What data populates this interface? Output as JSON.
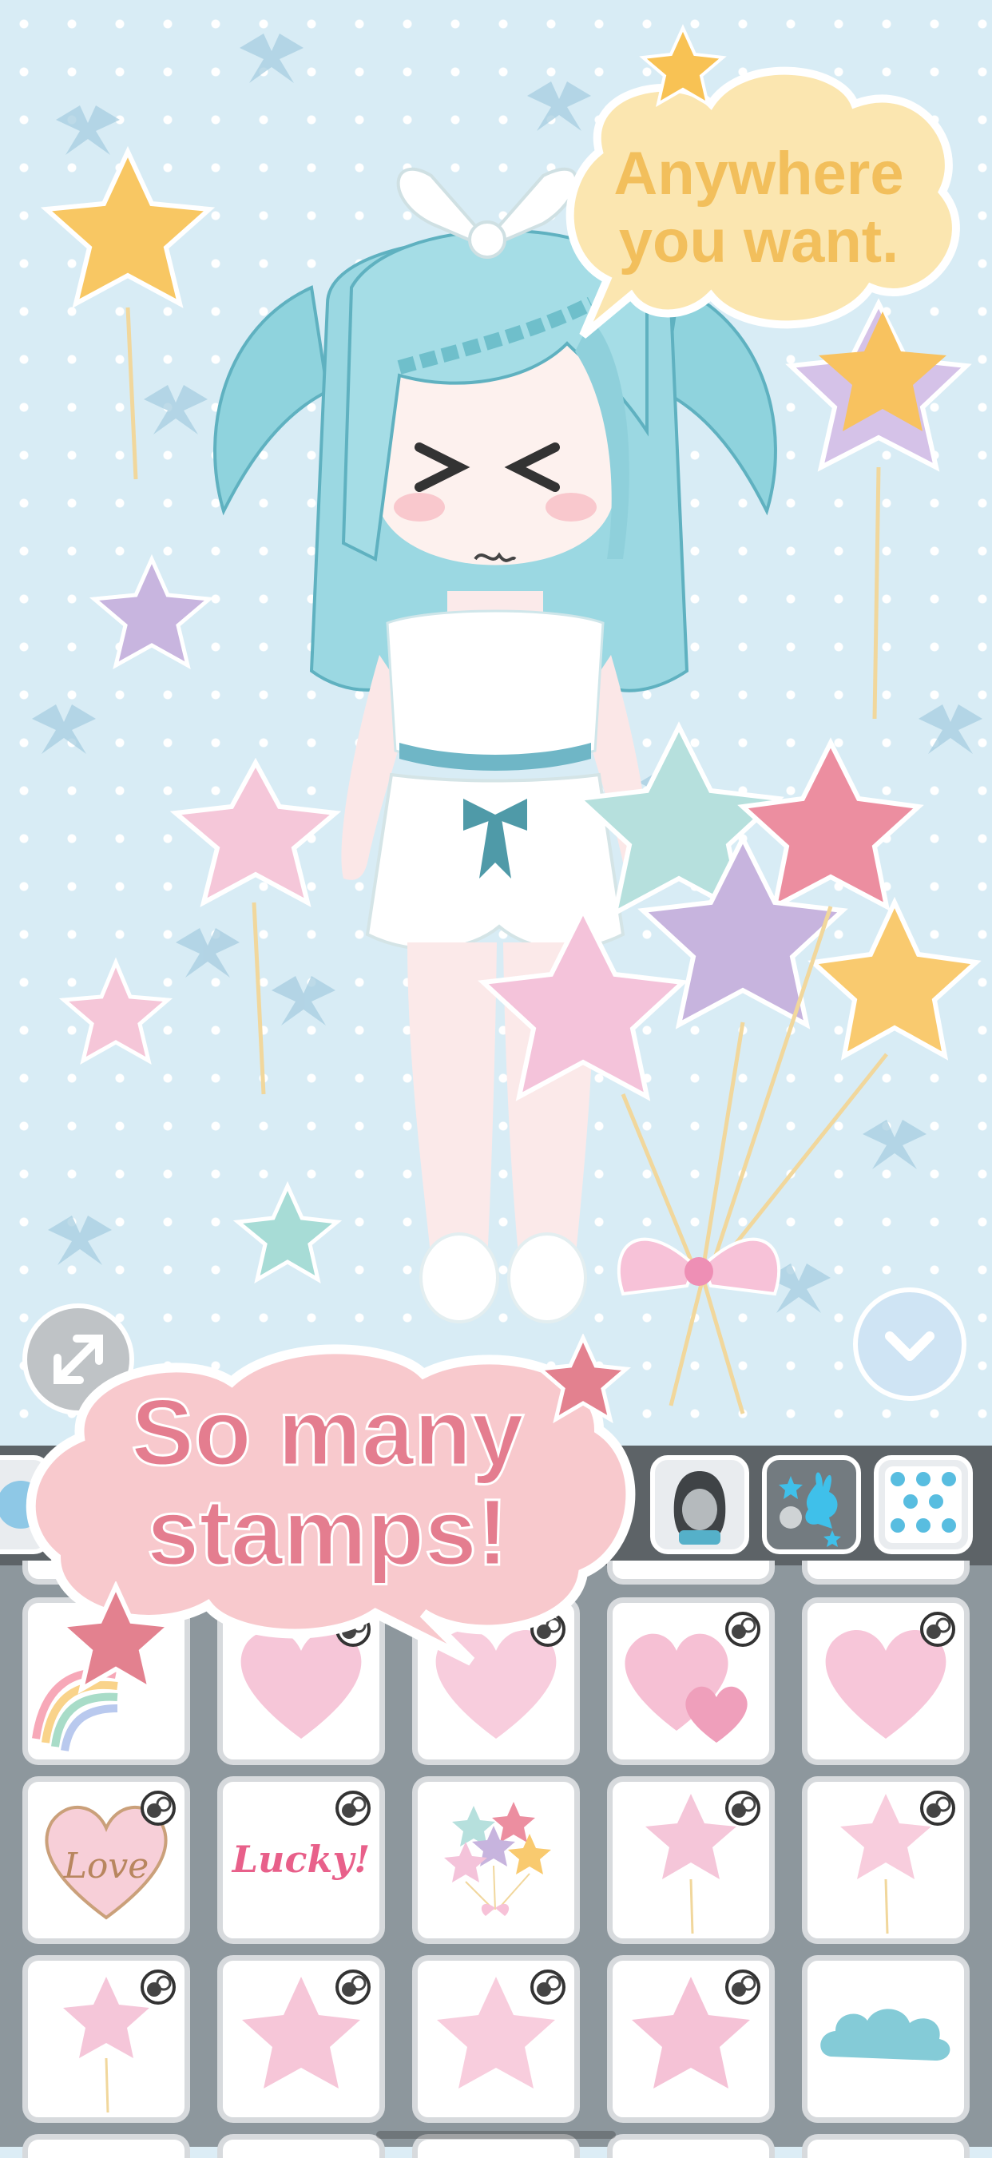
{
  "promo": {
    "top_line1": "Anywhere",
    "top_line2": "you want.",
    "bottom_line1": "So many",
    "bottom_line2": "stamps!"
  },
  "controls": {
    "expand_icon": "expand-arrows-icon",
    "collapse_icon": "chevron-down-icon"
  },
  "tabs": [
    {
      "icon": "body-stamp-icon",
      "active": false
    },
    {
      "icon": "face-silhouette-icon",
      "active": false
    },
    {
      "icon": "stamp-bunny-star-icon",
      "active": true
    },
    {
      "icon": "polka-dot-background-icon",
      "active": false
    }
  ],
  "stamps": {
    "row1": [
      "rainbow-star-stamp",
      "polka-heart-stamp",
      "striped-heart-stamp",
      "double-heart-stamp",
      "pink-heart-stamp"
    ],
    "row2": [
      "love-heart-stamp",
      "lucky-text-stamp",
      "balloon-bouquet-stamp",
      "polka-star-balloon-stamp",
      "striped-star-balloon-stamp"
    ],
    "row3": [
      "star-balloon-stamp",
      "polka-star-stamp",
      "striped-star-stamp",
      "pink-star-stamp",
      "blue-cloud-stamp"
    ],
    "love_text": "Love",
    "lucky_text": "Lucky!"
  },
  "colors": {
    "promo_text_pink": "#e47d8f",
    "promo_text_yellow": "#f2bf5c",
    "panel_bg": "#8d979d",
    "tab_bar_bg": "#5d6367",
    "scene_bg": "#d8ecf5"
  }
}
